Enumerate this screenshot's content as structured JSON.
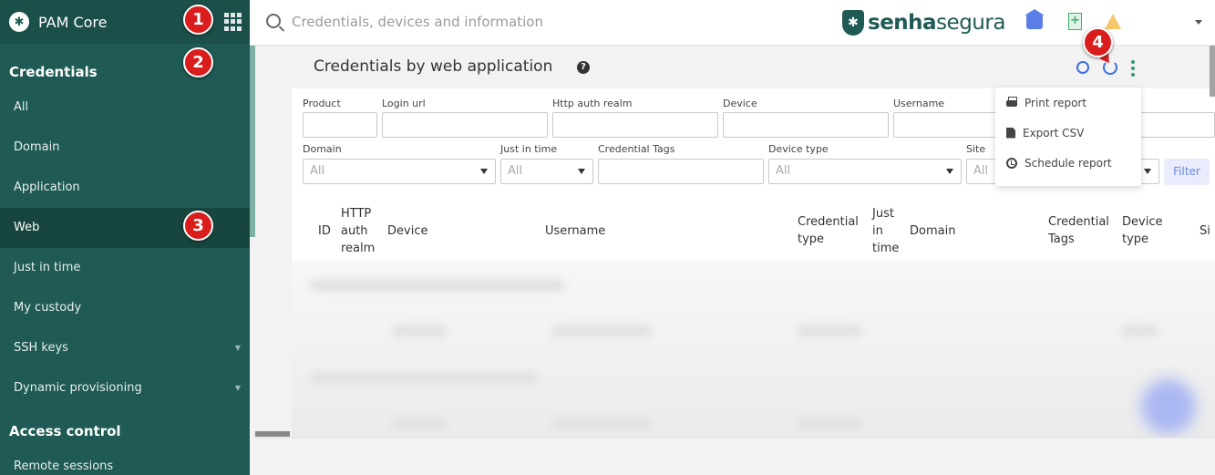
{
  "sidebar": {
    "app_title": "PAM Core",
    "sections": [
      {
        "title": "Credentials",
        "items": [
          {
            "label": "All"
          },
          {
            "label": "Domain"
          },
          {
            "label": "Application"
          },
          {
            "label": "Web",
            "active": true
          },
          {
            "label": "Just in time"
          },
          {
            "label": "My custody"
          },
          {
            "label": "SSH keys",
            "has_children": true
          },
          {
            "label": "Dynamic provisioning",
            "has_children": true
          }
        ]
      },
      {
        "title": "Access control",
        "items": [
          {
            "label": "Remote sessions"
          }
        ]
      }
    ]
  },
  "topbar": {
    "search_placeholder": "Credentials, devices and information",
    "brand_name_bold": "senha",
    "brand_name_rest": "segura",
    "icons": [
      "home-icon",
      "add-document-icon",
      "warning-icon",
      "user-menu-caret-icon"
    ]
  },
  "page": {
    "title": "Credentials by web application",
    "actions": [
      "search-icon",
      "refresh-icon",
      "more-vertical-icon"
    ]
  },
  "filters": {
    "row1": [
      {
        "label": "Product",
        "value": ""
      },
      {
        "label": "Login url",
        "value": ""
      },
      {
        "label": "Http auth realm",
        "value": ""
      },
      {
        "label": "Device",
        "value": ""
      },
      {
        "label": "Username",
        "value": ""
      }
    ],
    "row2": [
      {
        "label": "Domain",
        "value": "All"
      },
      {
        "label": "Just in time",
        "value": "All"
      },
      {
        "label": "Credential Tags",
        "value": ""
      },
      {
        "label": "Device type",
        "value": "All"
      },
      {
        "label": "Site",
        "value": "All"
      }
    ],
    "filter_button": "Filter"
  },
  "table": {
    "columns": [
      "ID",
      "HTTP auth realm",
      "Device",
      "Username",
      "Credential type",
      "Just in time",
      "Domain",
      "Credential Tags",
      "Device type",
      "Si"
    ]
  },
  "dropdown": {
    "items": [
      {
        "label": "Print report",
        "icon": "printer-icon"
      },
      {
        "label": "Export CSV",
        "icon": "file-icon"
      },
      {
        "label": "Schedule report",
        "icon": "clock-icon"
      }
    ]
  },
  "markers": [
    "1",
    "2",
    "3",
    "4"
  ],
  "colors": {
    "sidebar": "#1f5a54",
    "marker": "#d91c1c",
    "accent_blue": "#3b6fe0",
    "accent_green": "#2e9e68"
  }
}
